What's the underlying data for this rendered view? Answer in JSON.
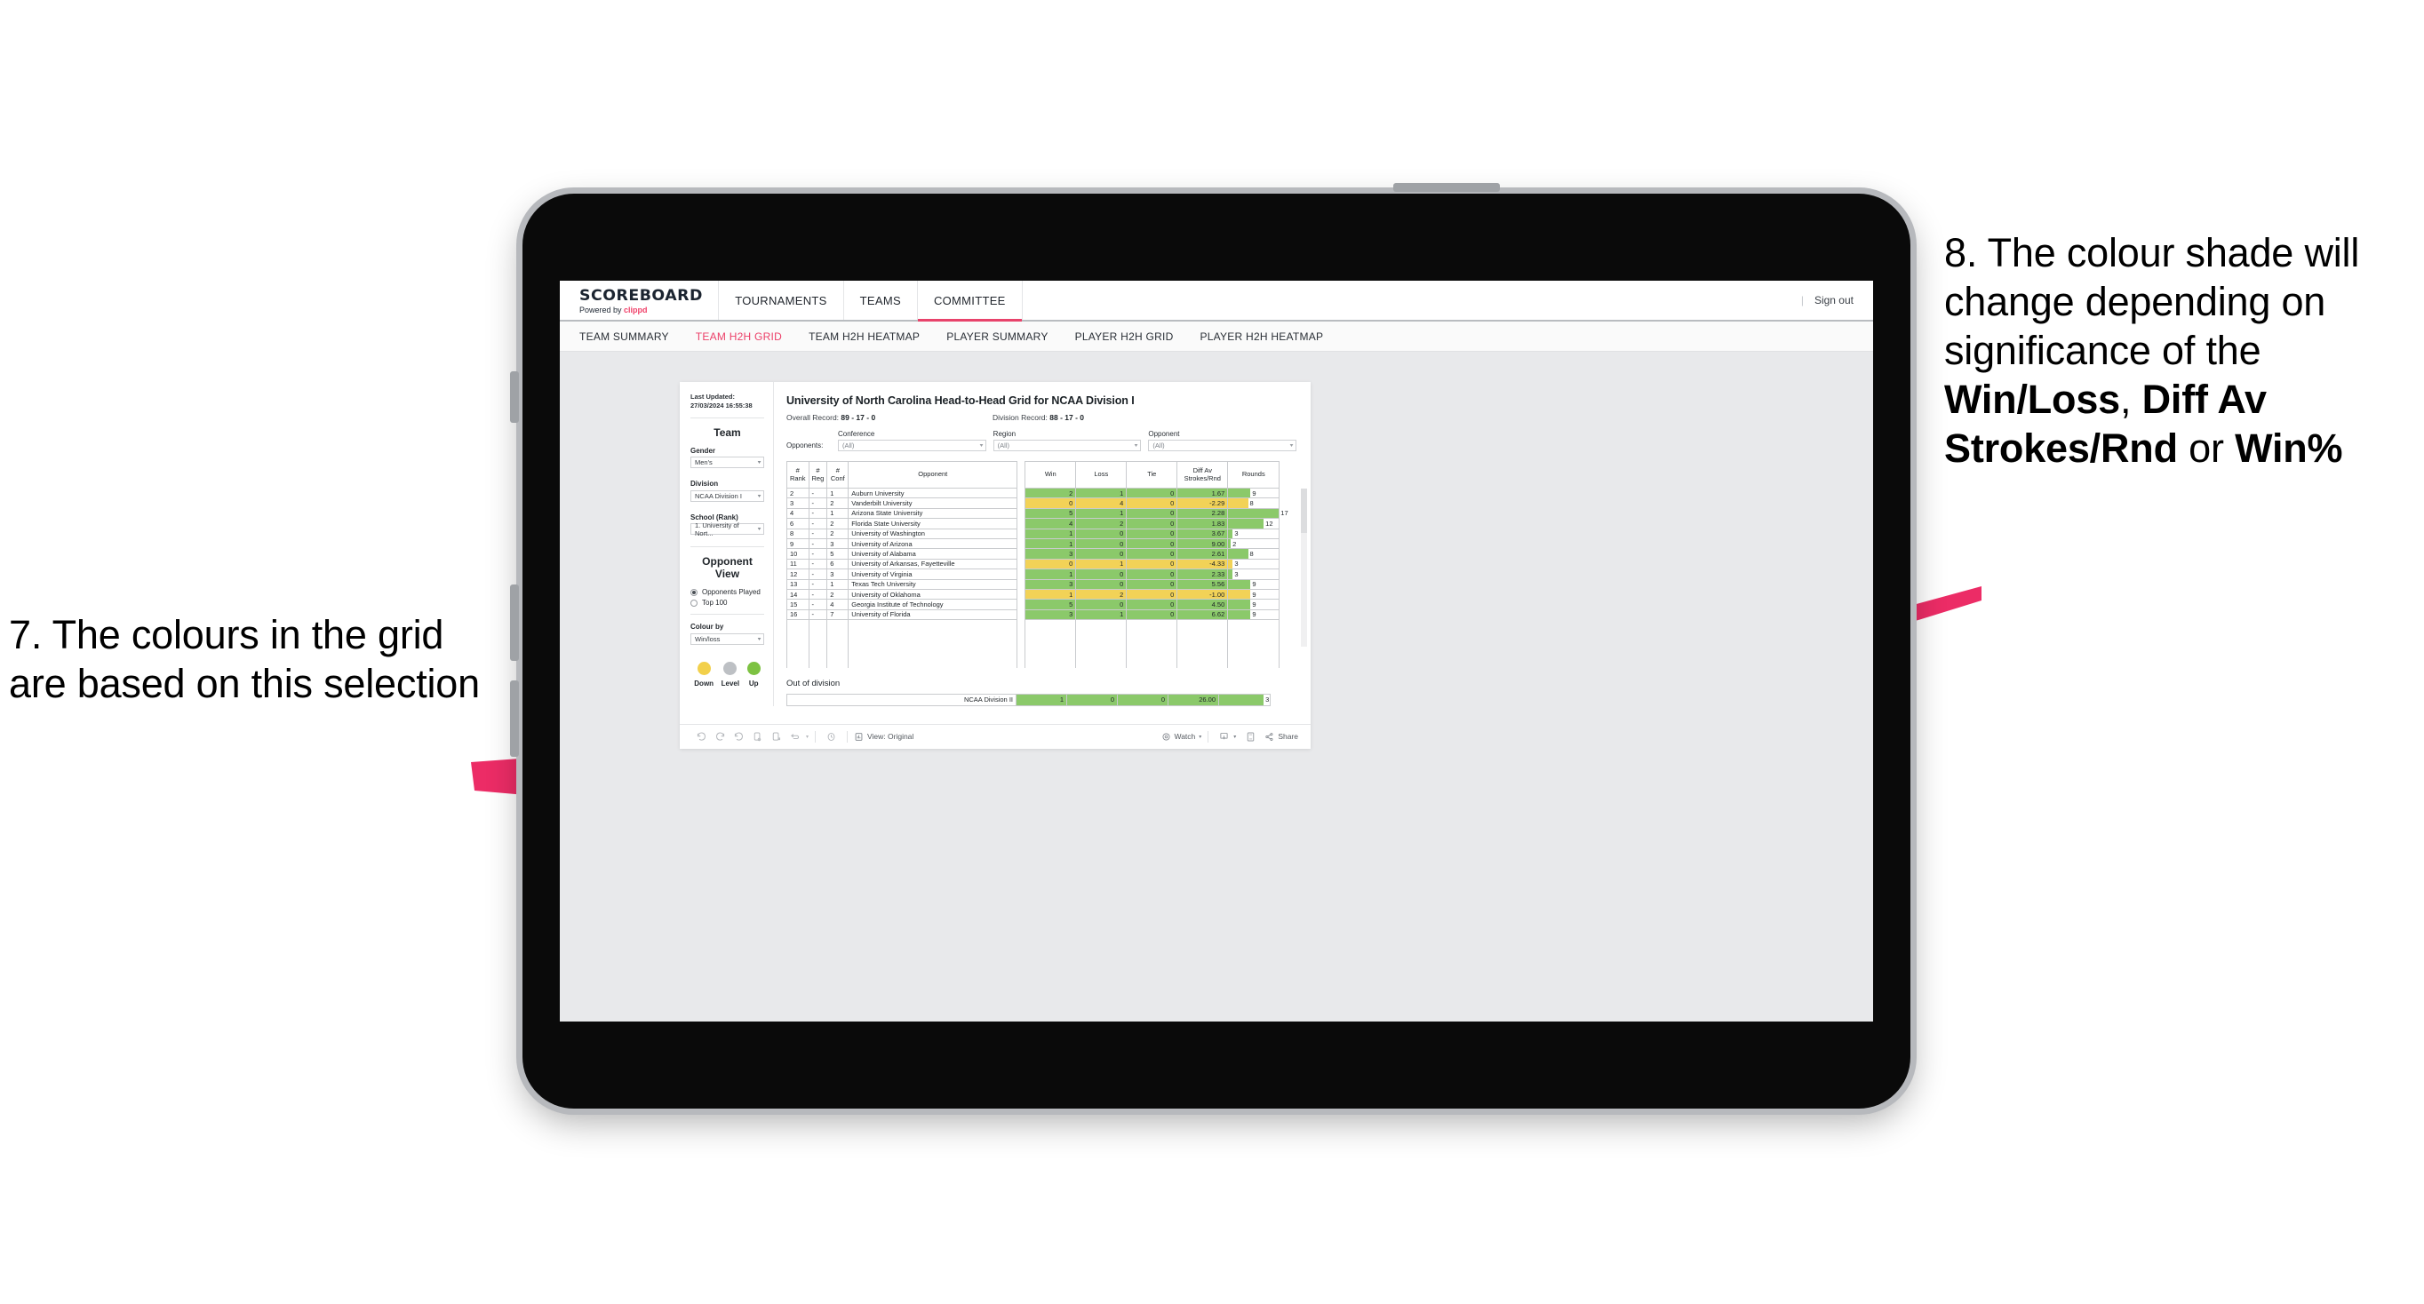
{
  "annotations": {
    "left": {
      "number": "7.",
      "text": "7. The colours in the grid are based on this selection"
    },
    "right": {
      "number": "8.",
      "pre": "8. The colour shade will change depending on significance of the ",
      "bold1": "Win/Loss",
      "mid1": ", ",
      "bold2": "Diff Av Strokes/Rnd",
      "mid2": " or ",
      "bold3": "Win%"
    },
    "arrow_color": "#ec2c66"
  },
  "app": {
    "brand": {
      "title": "SCOREBOARD",
      "powered_prefix": "Powered by ",
      "powered_brand": "clippd"
    },
    "topnav": [
      {
        "label": "TOURNAMENTS",
        "active": false
      },
      {
        "label": "TEAMS",
        "active": false
      },
      {
        "label": "COMMITTEE",
        "active": true
      }
    ],
    "signout": {
      "divider": "|",
      "label": "Sign out"
    },
    "subnav": [
      {
        "label": "TEAM SUMMARY",
        "active": false
      },
      {
        "label": "TEAM H2H GRID",
        "active": true
      },
      {
        "label": "TEAM H2H HEATMAP",
        "active": false
      },
      {
        "label": "PLAYER SUMMARY",
        "active": false
      },
      {
        "label": "PLAYER H2H GRID",
        "active": false
      },
      {
        "label": "PLAYER H2H HEATMAP",
        "active": false
      }
    ]
  },
  "sidebar": {
    "last_updated": "Last Updated: 27/03/2024 16:55:38",
    "team_heading": "Team",
    "gender": {
      "label": "Gender",
      "value": "Men's"
    },
    "division": {
      "label": "Division",
      "value": "NCAA Division I"
    },
    "school": {
      "label": "School (Rank)",
      "value": "1. University of Nort..."
    },
    "opponent_view": {
      "heading": "Opponent View",
      "options": [
        {
          "label": "Opponents Played",
          "selected": true
        },
        {
          "label": "Top 100",
          "selected": false
        }
      ]
    },
    "colour_by": {
      "label": "Colour by",
      "value": "Win/loss"
    },
    "legend": [
      {
        "label": "Down",
        "color": "#F2D04B"
      },
      {
        "label": "Level",
        "color": "#BDC0C4"
      },
      {
        "label": "Up",
        "color": "#7DC242"
      }
    ]
  },
  "main": {
    "title": "University of North Carolina Head-to-Head Grid for NCAA Division I",
    "overall_record_label": "Overall Record: ",
    "overall_record_value": "89 - 17 - 0",
    "division_record_label": "Division Record: ",
    "division_record_value": "88 - 17 - 0",
    "opponents_label": "Opponents:",
    "filters": [
      {
        "label": "Conference",
        "value": "(All)"
      },
      {
        "label": "Region",
        "value": "(All)"
      },
      {
        "label": "Opponent",
        "value": "(All)"
      }
    ],
    "columns": [
      "# Rank",
      "# Reg",
      "# Conf",
      "Opponent",
      "Win",
      "Loss",
      "Tie",
      "Diff Av Strokes/Rnd",
      "Rounds"
    ],
    "col_rank": "#\nRank",
    "col_reg": "#\nReg",
    "col_conf": "#\nConf",
    "col_opponent": "Opponent",
    "col_win": "Win",
    "col_loss": "Loss",
    "col_tie": "Tie",
    "col_diff": "Diff Av Strokes/Rnd",
    "col_rounds": "Rounds",
    "rows": [
      {
        "rank": "2",
        "reg": "-",
        "conf": "1",
        "opponent": "Auburn University",
        "win": "2",
        "loss": "1",
        "tie": "0",
        "diff": "1.67",
        "rounds": "9",
        "color": "#8BC96A",
        "bar_pct": 44
      },
      {
        "rank": "3",
        "reg": "-",
        "conf": "2",
        "opponent": "Vanderbilt University",
        "win": "0",
        "loss": "4",
        "tie": "0",
        "diff": "-2.29",
        "rounds": "8",
        "color": "#F2D257",
        "bar_pct": 39
      },
      {
        "rank": "4",
        "reg": "-",
        "conf": "1",
        "opponent": "Arizona State University",
        "win": "5",
        "loss": "1",
        "tie": "0",
        "diff": "2.28",
        "rounds": "17",
        "color": "#8BC96A",
        "bar_pct": 100
      },
      {
        "rank": "6",
        "reg": "-",
        "conf": "2",
        "opponent": "Florida State University",
        "win": "4",
        "loss": "2",
        "tie": "0",
        "diff": "1.83",
        "rounds": "12",
        "color": "#8BC96A",
        "bar_pct": 70
      },
      {
        "rank": "8",
        "reg": "-",
        "conf": "2",
        "opponent": "University of Washington",
        "win": "1",
        "loss": "0",
        "tie": "0",
        "diff": "3.67",
        "rounds": "3",
        "color": "#8BC96A",
        "bar_pct": 9
      },
      {
        "rank": "9",
        "reg": "-",
        "conf": "3",
        "opponent": "University of Arizona",
        "win": "1",
        "loss": "0",
        "tie": "0",
        "diff": "9.00",
        "rounds": "2",
        "color": "#8BC96A",
        "bar_pct": 5
      },
      {
        "rank": "10",
        "reg": "-",
        "conf": "5",
        "opponent": "University of Alabama",
        "win": "3",
        "loss": "0",
        "tie": "0",
        "diff": "2.61",
        "rounds": "8",
        "color": "#8BC96A",
        "bar_pct": 39
      },
      {
        "rank": "11",
        "reg": "-",
        "conf": "6",
        "opponent": "University of Arkansas, Fayetteville",
        "win": "0",
        "loss": "1",
        "tie": "0",
        "diff": "-4.33",
        "rounds": "3",
        "color": "#F2D257",
        "bar_pct": 9
      },
      {
        "rank": "12",
        "reg": "-",
        "conf": "3",
        "opponent": "University of Virginia",
        "win": "1",
        "loss": "0",
        "tie": "0",
        "diff": "2.33",
        "rounds": "3",
        "color": "#8BC96A",
        "bar_pct": 9
      },
      {
        "rank": "13",
        "reg": "-",
        "conf": "1",
        "opponent": "Texas Tech University",
        "win": "3",
        "loss": "0",
        "tie": "0",
        "diff": "5.56",
        "rounds": "9",
        "color": "#8BC96A",
        "bar_pct": 44
      },
      {
        "rank": "14",
        "reg": "-",
        "conf": "2",
        "opponent": "University of Oklahoma",
        "win": "1",
        "loss": "2",
        "tie": "0",
        "diff": "-1.00",
        "rounds": "9",
        "color": "#F2D257",
        "bar_pct": 44
      },
      {
        "rank": "15",
        "reg": "-",
        "conf": "4",
        "opponent": "Georgia Institute of Technology",
        "win": "5",
        "loss": "0",
        "tie": "0",
        "diff": "4.50",
        "rounds": "9",
        "color": "#8BC96A",
        "bar_pct": 44
      },
      {
        "rank": "16",
        "reg": "-",
        "conf": "7",
        "opponent": "University of Florida",
        "win": "3",
        "loss": "1",
        "tie": "0",
        "diff": "6.62",
        "rounds": "9",
        "color": "#8BC96A",
        "bar_pct": 44
      }
    ],
    "out_of_division": {
      "title": "Out of division",
      "row": {
        "name": "NCAA Division II",
        "win": "1",
        "loss": "0",
        "tie": "0",
        "diff": "26.00",
        "rounds": "3",
        "color": "#8BC96A",
        "bar_pct": 88
      }
    }
  },
  "toolbar": {
    "icons": [
      "undo-icon",
      "redo-icon",
      "revert-icon",
      "refresh-icon",
      "pause-icon",
      "custom-view-icon",
      "clock-icon"
    ],
    "view_label": "View: Original",
    "watch_label": "Watch",
    "share_label": "Share",
    "download_icon": "download-icon",
    "fullscreen_icon": "fullscreen-icon"
  },
  "colors": {
    "accent": "#ec3f68",
    "green": "#8BC96A",
    "yellow": "#F2D257",
    "grey": "#BDC0C4"
  }
}
